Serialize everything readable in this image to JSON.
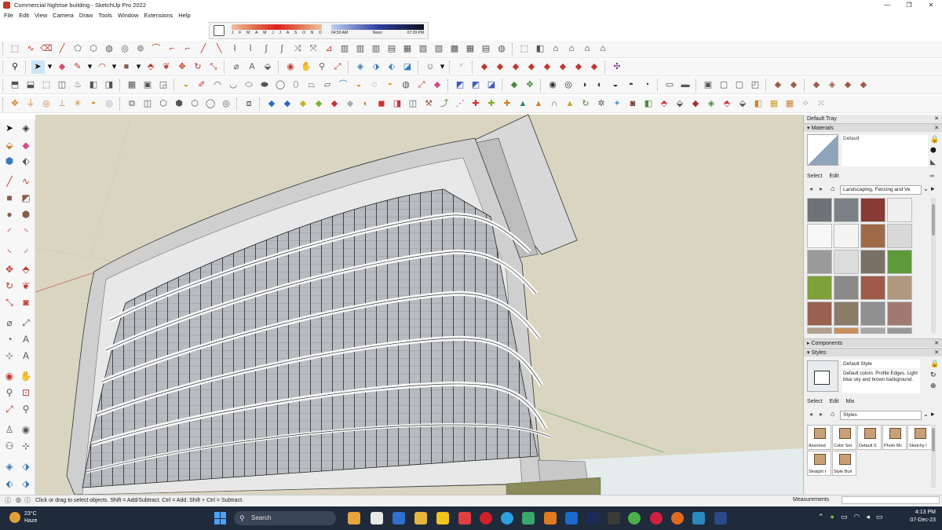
{
  "window": {
    "title": "Commercial highrise building - SketchUp Pro 2022",
    "minimize": "—",
    "maximize": "❐",
    "close": "✕"
  },
  "menu": [
    "File",
    "Edit",
    "View",
    "Camera",
    "Draw",
    "Tools",
    "Window",
    "Extensions",
    "Help"
  ],
  "shadow": {
    "months": [
      "J",
      "F",
      "M",
      "A",
      "M",
      "J",
      "J",
      "A",
      "S",
      "O",
      "N",
      "D"
    ],
    "time_start": "04:50 AM",
    "time_mid": "Noon",
    "time_end": "07:39 PM"
  },
  "tray": {
    "title": "Default Tray",
    "materials": {
      "header": "Materials",
      "current": "Default",
      "tab_select": "Select",
      "tab_edit": "Edit",
      "library": "Landscaping, Fencing and Ve",
      "swatches": [
        "#6f7378",
        "#7d8187",
        "#8a3a34",
        "#efefef",
        "#f8f8f8",
        "#f4f4f4",
        "#a06a48",
        "#d8d8d8",
        "#9a9a9a",
        "#dcdcdc",
        "#7a7066",
        "#5e9a3a",
        "#7fa03a",
        "#8a8a88",
        "#a05a4a",
        "#b09880",
        "#9a6050",
        "#8a7a68",
        "#909090",
        "#a07a70",
        "#b0a090",
        "#c89060",
        "#a8a8a8",
        "#9a9a9a"
      ]
    },
    "components": {
      "header": "Components"
    },
    "styles": {
      "header": "Styles",
      "current": "Default Style",
      "description": "Default colors. Profile Edges. Light blue sky and brown background.",
      "tab_select": "Select",
      "tab_edit": "Edit",
      "tab_mix": "Mix",
      "library": "Styles",
      "tiles": [
        "Assorted",
        "Color Set",
        "Default S",
        "Photo Mc",
        "Sketchy I",
        "Straight I",
        "Style Buil"
      ]
    }
  },
  "status": {
    "message": "Click or drag to select objects. Shift = Add/Subtract. Ctrl = Add. Shift + Ctrl = Subtract.",
    "measurements_label": "Measurements"
  },
  "taskbar": {
    "temp": "23°C",
    "weather": "Haze",
    "search": "Search",
    "time": "4:13 PM",
    "date": "07-Dec-23"
  },
  "colors": {
    "viewport_bg": "#d9d5c1",
    "ground": "#e4ecec",
    "taskbar": "#1f2a3a"
  }
}
